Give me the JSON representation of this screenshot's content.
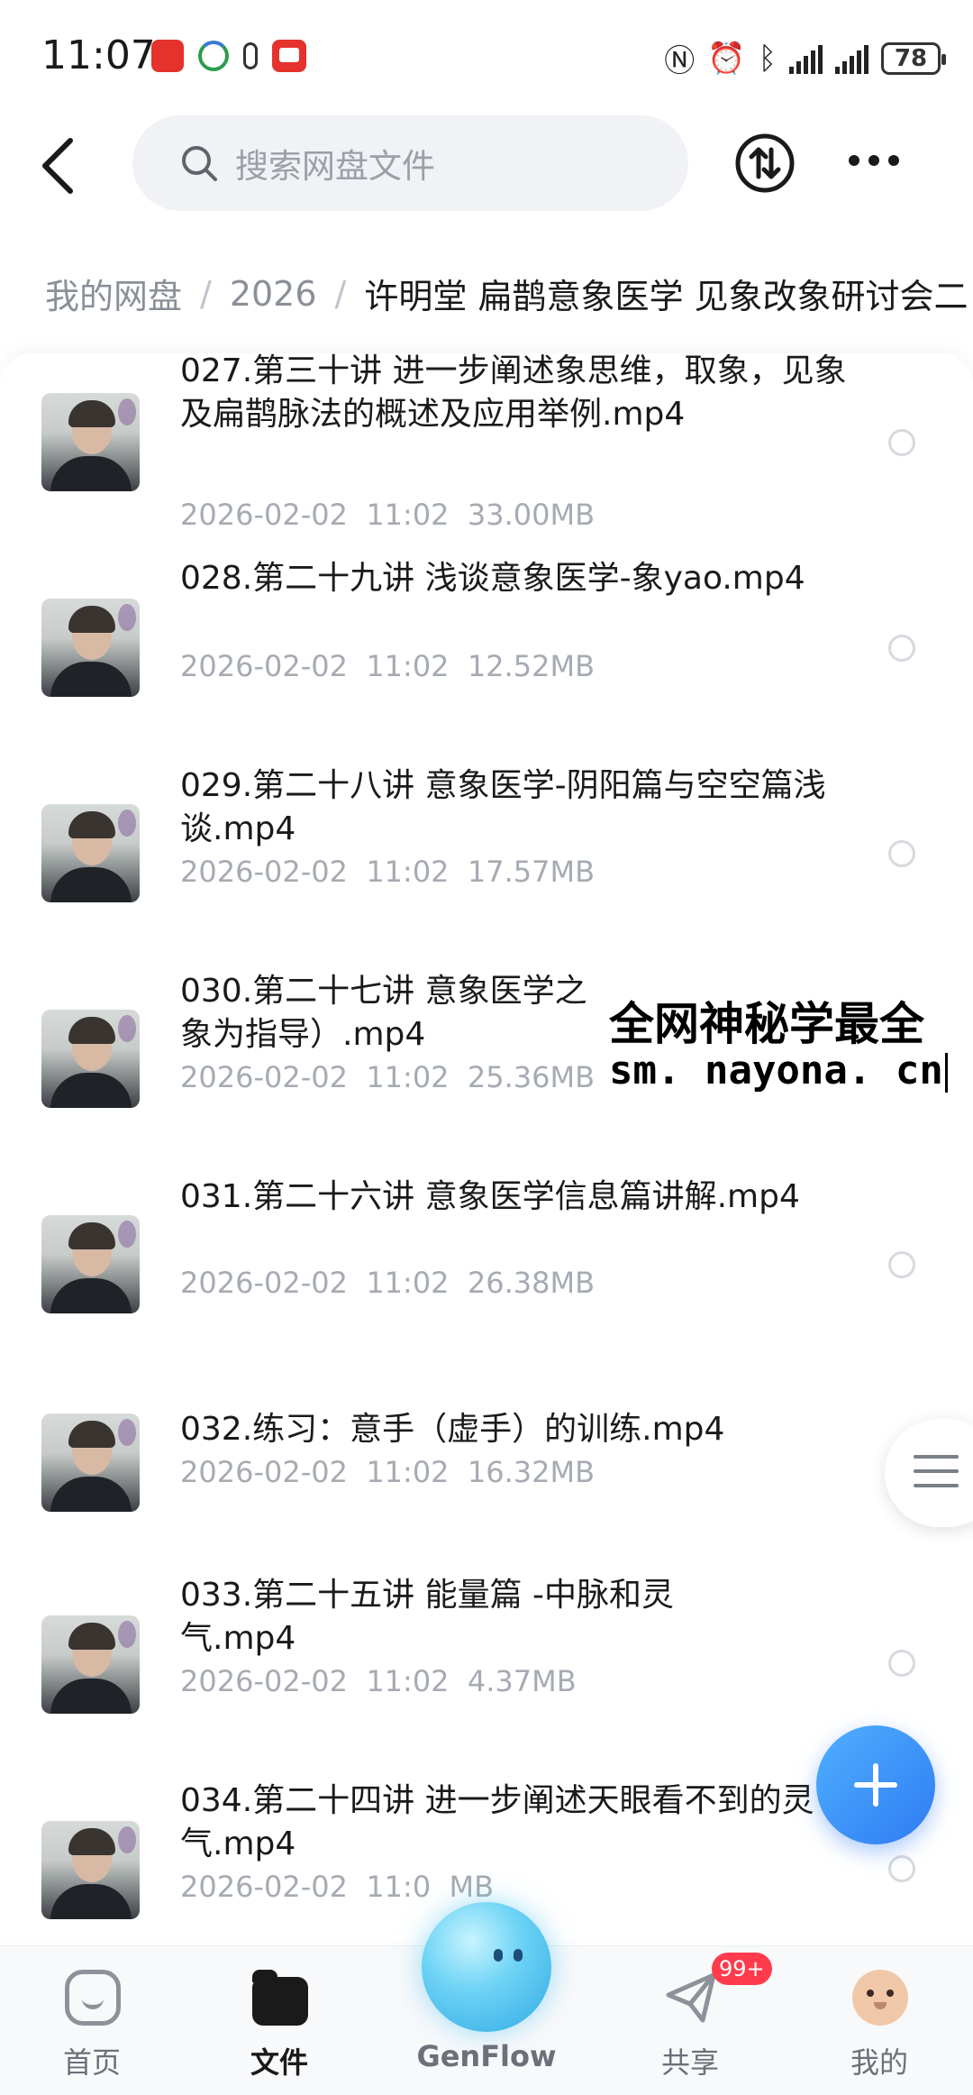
{
  "status_bar": {
    "time": "11:07",
    "battery": "78",
    "left_icons": [
      "huawei-app-icon",
      "mobile-network-icon",
      "small-app-icon",
      "red-app-icon"
    ],
    "right_icons": [
      "nfc-icon",
      "alarm-icon",
      "bluetooth-icon",
      "signal-icon",
      "signal-icon",
      "battery-icon"
    ]
  },
  "header": {
    "search_placeholder": "搜索网盘文件",
    "icons": [
      "back-icon",
      "search-icon",
      "transfer-icon",
      "more-icon"
    ]
  },
  "breadcrumb": {
    "items": [
      "我的网盘",
      "2026"
    ],
    "separator": "/",
    "current": "许明堂 扁鹊意象医学 见象改象研讨会二"
  },
  "files": [
    {
      "name": "027.第三十讲 进一步阐述象思维，取象，见象及扁鹊脉法的概述及应用举例.mp4",
      "date": "2026-02-02",
      "time": "11:02",
      "size": "33.00MB"
    },
    {
      "name": "028.第二十九讲 浅谈意象医学-象yao.mp4",
      "date": "2026-02-02",
      "time": "11:02",
      "size": "12.52MB"
    },
    {
      "name": "029.第二十八讲 意象医学-阴阳篇与空空篇浅谈.mp4",
      "date": "2026-02-02",
      "time": "11:02",
      "size": "17.57MB"
    },
    {
      "name": "030.第二十七讲 意象医学之",
      "name_line2": "象为指导）.mp4",
      "date": "2026-02-02",
      "time": "11:02",
      "size": "25.36MB"
    },
    {
      "name": "031.第二十六讲 意象医学信息篇讲解.mp4",
      "date": "2026-02-02",
      "time": "11:02",
      "size": "26.38MB"
    },
    {
      "name": "032.练习：意手（虚手）的训练.mp4",
      "date": "2026-02-02",
      "time": "11:02",
      "size": "16.32MB"
    },
    {
      "name": "033.第二十五讲 能量篇 -中脉和灵气.mp4",
      "date": "2026-02-02",
      "time": "11:02",
      "size": "4.37MB"
    },
    {
      "name": "034.第二十四讲  进一步阐述天眼看不到的灵气.mp4",
      "date": "2026-02-02",
      "time": "11:0",
      "size": "MB"
    }
  ],
  "watermark": {
    "line1": "全网神秘学最全",
    "line2": "sm. nayona. cn"
  },
  "bottom_nav": {
    "items": [
      {
        "label": "首页",
        "icon": "home-icon",
        "active": false
      },
      {
        "label": "文件",
        "icon": "folder-icon",
        "active": true
      },
      {
        "label": "GenFlow",
        "icon": "genflow-mascot-icon",
        "active": false
      },
      {
        "label": "共享",
        "icon": "share-plane-icon",
        "active": false
      },
      {
        "label": "我的",
        "icon": "avatar-icon",
        "active": false
      }
    ],
    "share_badge": "99+"
  },
  "colors": {
    "accent": "#2f7bf2",
    "badge": "#ff3b4d",
    "meta_text": "#a6abb3"
  }
}
